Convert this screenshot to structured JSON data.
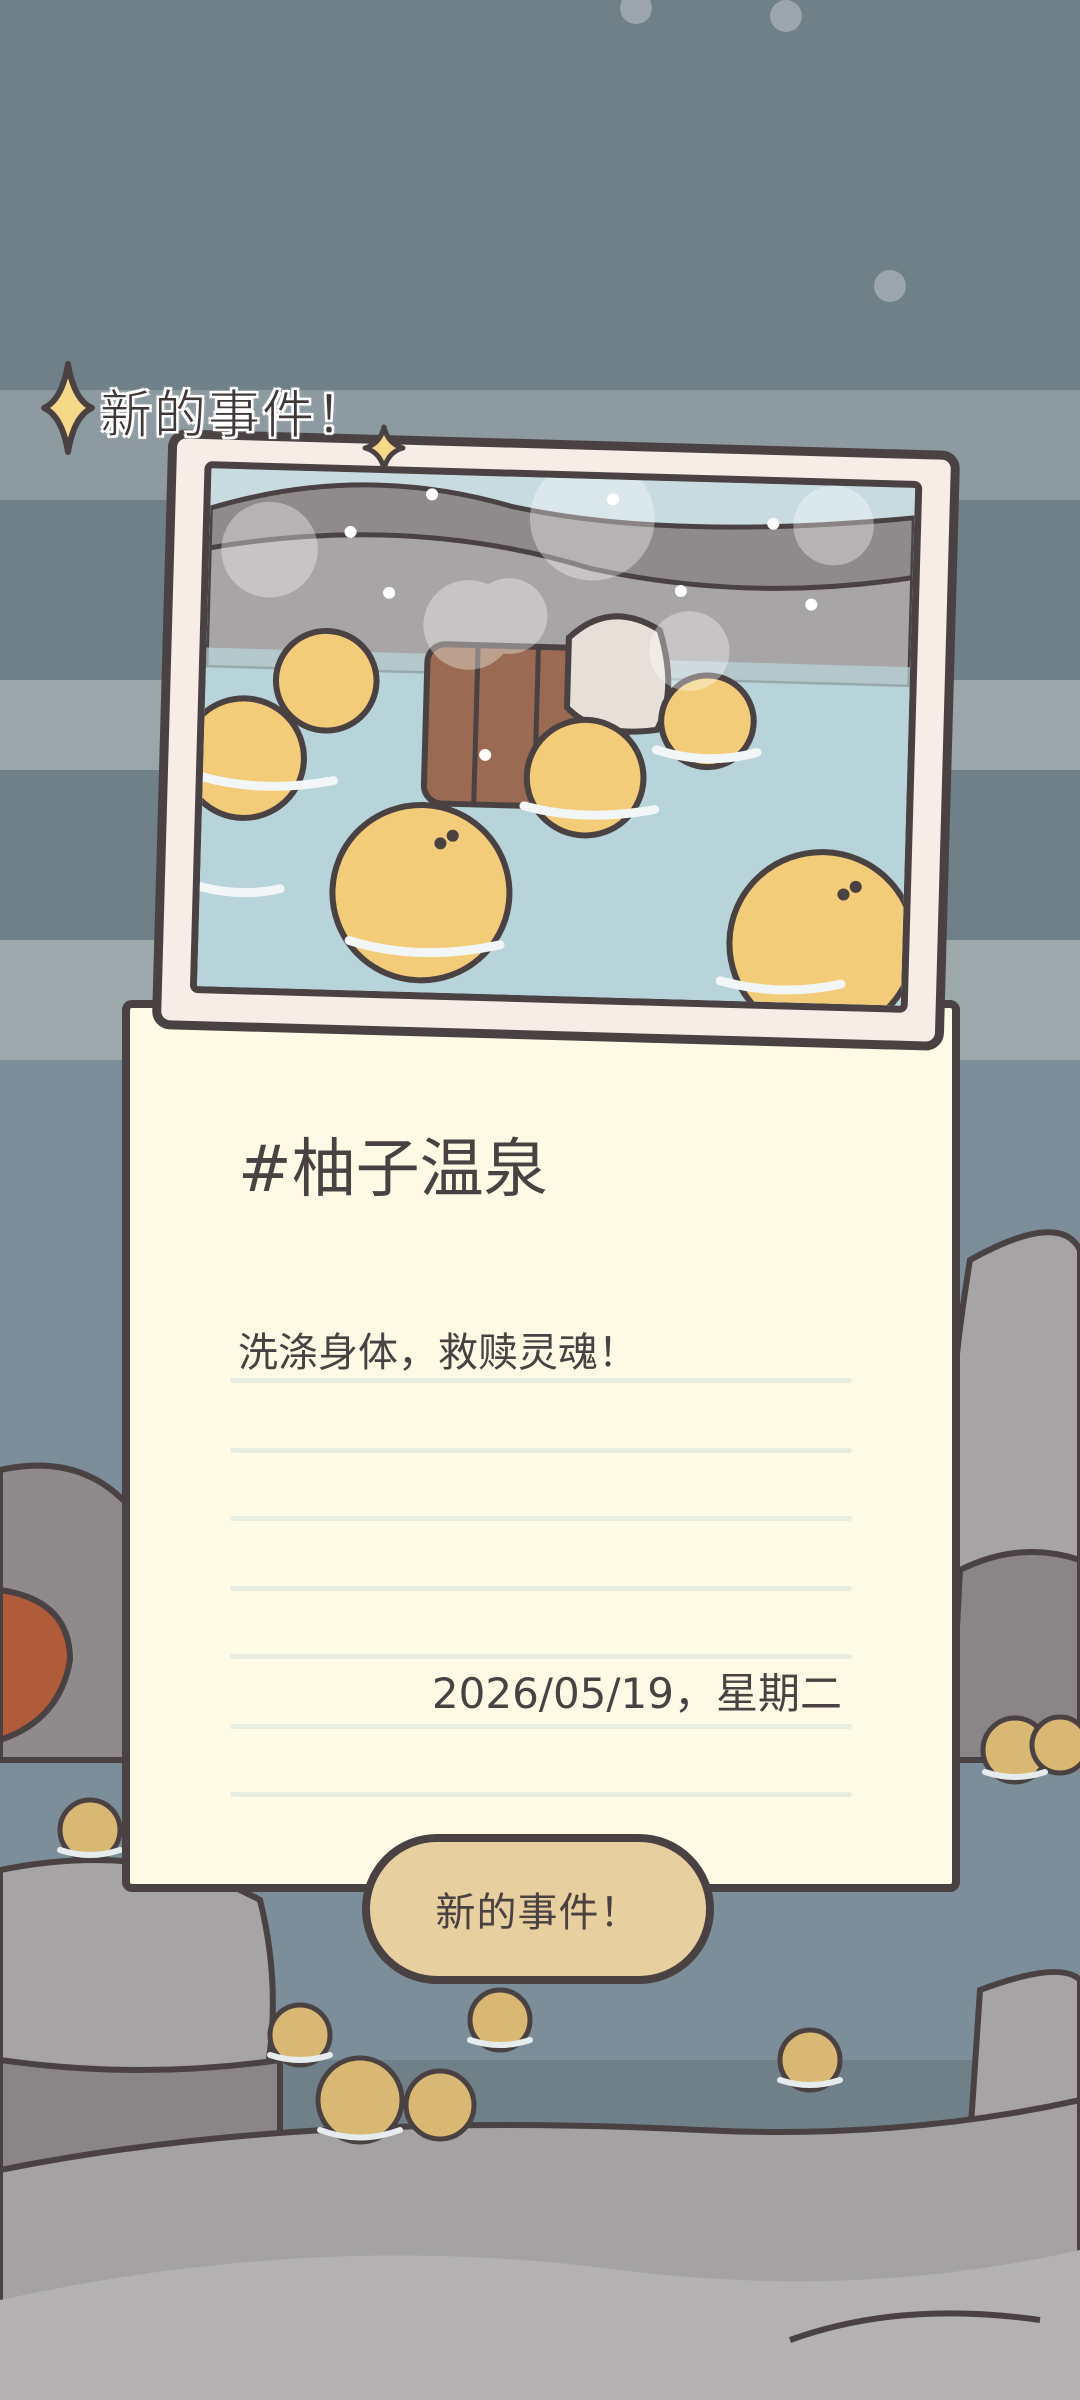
{
  "event_tag": {
    "label": "新的事件！"
  },
  "event_card": {
    "title": "#柚子温泉",
    "description": "洗涤身体，救赎灵魂！",
    "date": "2026/05/19，星期二"
  },
  "action_button": {
    "label": "新的事件！"
  },
  "colors": {
    "outline": "#4a4142",
    "note_paper": "#fdfbe6",
    "photo_frame": "#f7ede6",
    "button_fill": "#e8cf9f",
    "yuzu": "#f2cc78",
    "sparkle": "#f6d889",
    "background_water": "#7b8e99",
    "rocks": "#a4a2a2"
  },
  "icons": [
    "sparkle-icon",
    "sparkle-small-icon"
  ]
}
